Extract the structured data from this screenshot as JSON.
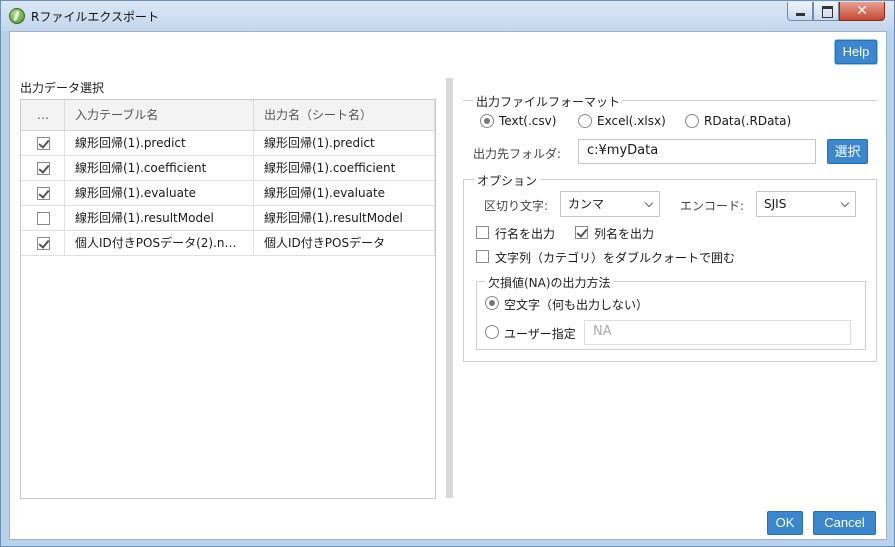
{
  "window": {
    "title": "Rファイルエクスポート"
  },
  "help_label": "Help",
  "left": {
    "section_title": "出力データ選択",
    "columns": [
      "…",
      "入力テーブル名",
      "出力名（シート名）"
    ],
    "rows": [
      {
        "checked": true,
        "input": "線形回帰(1).predict",
        "output": "線形回帰(1).predict"
      },
      {
        "checked": true,
        "input": "線形回帰(1).coefficient",
        "output": "線形回帰(1).coefficient"
      },
      {
        "checked": true,
        "input": "線形回帰(1).evaluate",
        "output": "線形回帰(1).evaluate"
      },
      {
        "checked": false,
        "input": "線形回帰(1).resultModel",
        "output": "線形回帰(1).resultModel"
      },
      {
        "checked": true,
        "input": "個人ID付きPOSデータ(2).n…",
        "output": "個人ID付きPOSデータ"
      }
    ]
  },
  "format": {
    "legend": "出力ファイルフォーマット",
    "options": [
      "Text(.csv)",
      "Excel(.xlsx)",
      "RData(.RData)"
    ],
    "selected": "Text(.csv)"
  },
  "folder": {
    "label": "出力先フォルダ:",
    "value": "c:¥myData",
    "select_button": "選択"
  },
  "options": {
    "legend": "オプション",
    "delimiter_label": "区切り文字:",
    "delimiter_value": "カンマ",
    "encode_label": "エンコード:",
    "encode_value": "SJIS",
    "row_names_label": "行名を出力",
    "row_names_checked": false,
    "col_names_label": "列名を出力",
    "col_names_checked": true,
    "quote_label": "文字列（カテゴリ）をダブルクォートで囲む",
    "quote_checked": false
  },
  "na": {
    "legend": "欠損値(NA)の出力方法",
    "empty_label": "空文字（何も出力しない）",
    "custom_label": "ユーザー指定",
    "custom_placeholder": "NA",
    "selected": "empty"
  },
  "footer": {
    "ok_label": "OK",
    "cancel_label": "Cancel"
  },
  "colors": {
    "accent": "#3a87d0",
    "title_bar": "#c2d6ec",
    "close_button": "#c7472f"
  }
}
